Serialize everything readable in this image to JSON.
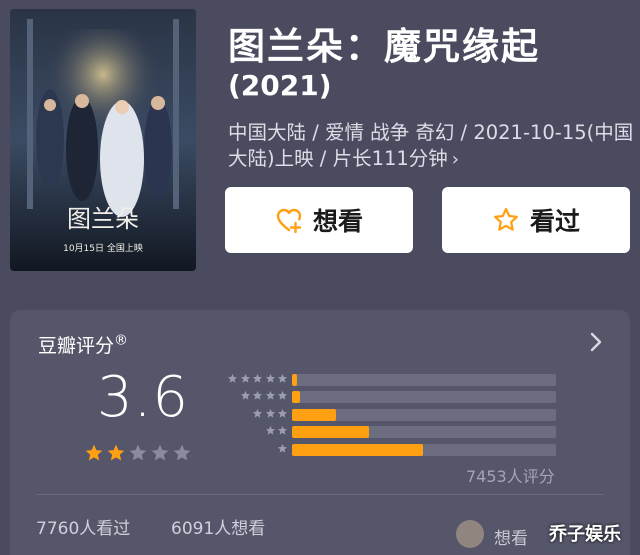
{
  "movie": {
    "title": "图兰朵：魔咒缘起",
    "year": "(2021)",
    "meta": "中国大陆 / 爱情 战争 奇幻 / 2021-10-15(中国大陆)上映 / 片长111分钟",
    "meta_chevron": "›"
  },
  "poster": {
    "title_text": "图兰朵",
    "release_text": "10月15日 全国上映",
    "icon": "movie-poster-image"
  },
  "actions": {
    "want_label": "想看",
    "want_icon": "heart-plus-icon",
    "seen_label": "看过",
    "seen_icon": "star-outline-icon"
  },
  "rating": {
    "title": "豆瓣评分",
    "registered_mark": "®",
    "score": "3.6",
    "score_stars_filled": 2,
    "score_stars_total": 5,
    "distribution": [
      {
        "stars": 5,
        "percent": 1.8
      },
      {
        "stars": 4,
        "percent": 3.2
      },
      {
        "stars": 3,
        "percent": 16.5
      },
      {
        "stars": 2,
        "percent": 29.0
      },
      {
        "stars": 1,
        "percent": 49.5
      }
    ],
    "count_text": "7453人评分",
    "watched_text": "7760人看过",
    "wanted_text": "6091人想看"
  },
  "watermark": {
    "text": "想看",
    "brand": "乔子娱乐"
  },
  "colors": {
    "background": "#4a4b5f",
    "card": "#55566a",
    "accent": "#ff9f12",
    "button_bg": "#ffffff",
    "track": "#6c6d80"
  }
}
